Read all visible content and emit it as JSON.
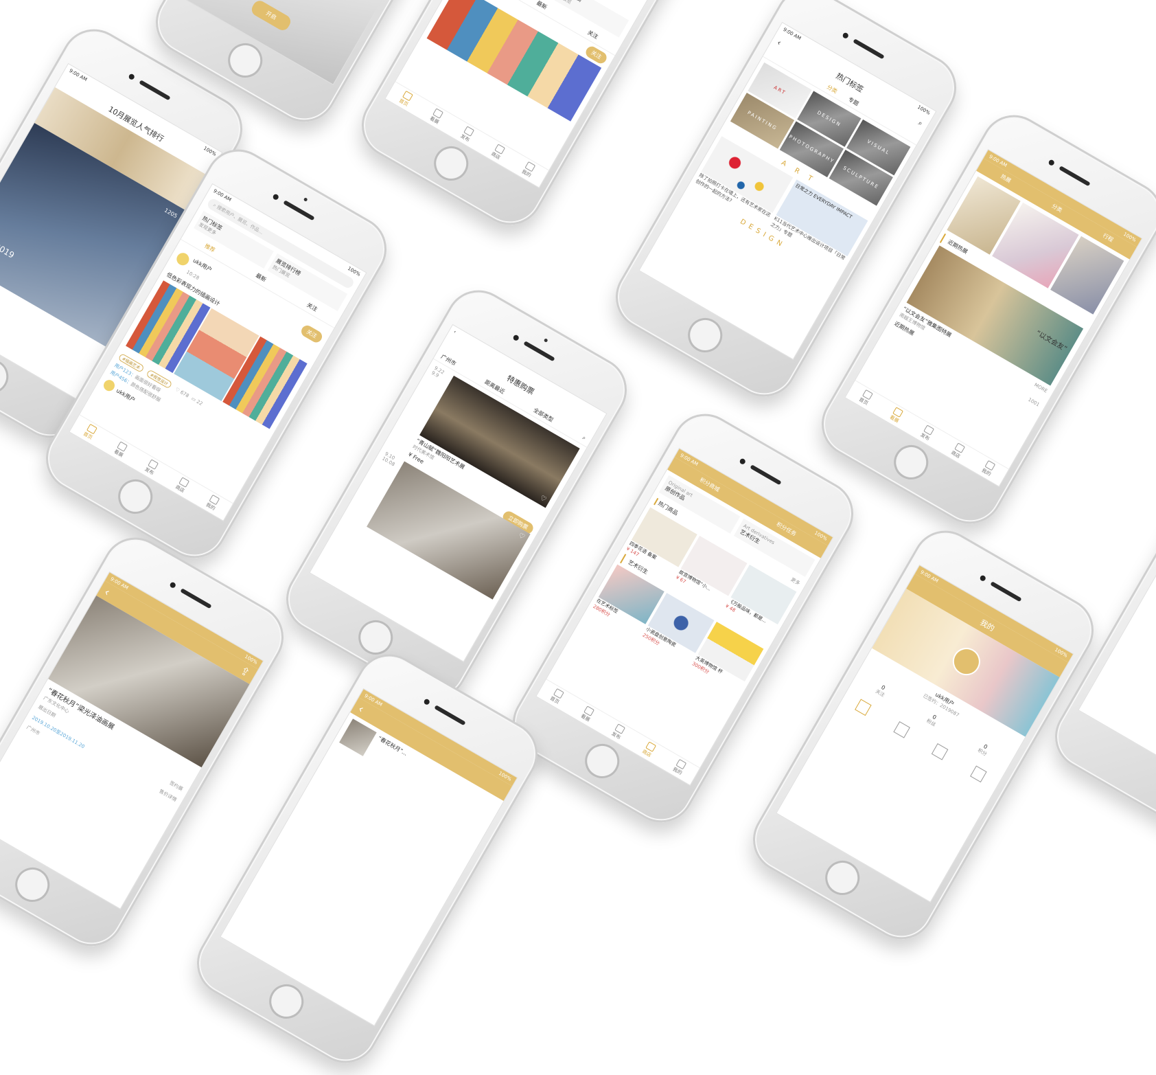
{
  "status": {
    "time": "9:00 AM",
    "battery": "100%"
  },
  "ranking": {
    "title": "10月展览人气排行",
    "views": "1205",
    "year": "2019"
  },
  "home": {
    "search_placeholder": "搜索用户、展览、作品...",
    "hot_tags": "热门标签",
    "hot_tags_sub": "发现更多",
    "rank_list": "展览排行榜",
    "rank_sub": "热门展览",
    "tabs": [
      "推荐",
      "最新",
      "关注"
    ],
    "user": "ukk用户",
    "post_time": "10:28",
    "post_text": "低色彩表现力的插画设计",
    "follow": "关注",
    "tag_a": "#插画艺术",
    "tag_b": "#视觉设计",
    "likes": "678",
    "comments": "22",
    "comment1_user": "用户123：",
    "comment1": "画面很好看呀",
    "comment2_user": "用户456：",
    "comment2": "颜色搭配很舒服"
  },
  "tabbar": [
    "首页",
    "看展",
    "发布",
    "商店",
    "我的"
  ],
  "opener": {
    "button": "开启"
  },
  "tags_page": {
    "title": "热门标签",
    "subtabs": [
      "分类",
      "专题"
    ],
    "cats": [
      "ART",
      "DESIGN",
      "VISUAL",
      "PAINTING",
      "PHOTOGRAPHY",
      "SCULPTURE"
    ],
    "art_word": "A R T",
    "design_word": "DESIGN",
    "card1": "除了拍照打卡在墙上，还有艺术家在这创作的一起的方法?",
    "card2": "K11当代艺术中心推出设计项目「日常之力」专题",
    "everyday": "日常之力 EVERYDAY IMPACT"
  },
  "tickets": {
    "title": "特惠购票",
    "city": "广州市",
    "sort": "距离最近",
    "filter": "全部类型",
    "date1": "9.22",
    "date1b": "9.9",
    "ex1": "“青山赋”魏阳阳艺术展",
    "ex1_venue": "时代美术馆",
    "price": "¥ Free",
    "date2": "9.10",
    "date2b": "10.08",
    "buy": "立即购票"
  },
  "points": {
    "tabs": [
      "积分商城",
      "积分任务"
    ],
    "original": "原创作品",
    "original_en": "Original art",
    "derivative": "艺术衍生",
    "derivative_en": "Art derivatives",
    "hot": "热门商品",
    "more": "更多",
    "item1": "四季花语 备案",
    "item1_price": "¥ 147",
    "item2": "故宫博物馆“小...",
    "item2_price": "¥ 67",
    "item3": "《万般品味，都是...",
    "item3_price": "¥ 48",
    "sect2": "艺术衍生",
    "p1": "在艺术标签",
    "p1_pts": "280积分",
    "p2": "小瓷盘创意陶瓷",
    "p2_pts": "250积分",
    "p3": "大英博物馆 杯",
    "p3_pts": "300积分"
  },
  "category_home": {
    "tabs": [
      "热展",
      "分类",
      "行程"
    ],
    "near": "近期热展",
    "ex1": "“以文会友”雅集图特展",
    "ex1_venue": "南越王博物馆",
    "ex1_sub": "“以文会友”",
    "near2": "近期热展",
    "more": "MORE",
    "views": "1001"
  },
  "detail": {
    "title": "“春花秋月”梁光泽油画展",
    "venue": "广东文化中心",
    "date_label": "展出日期",
    "date": "2019.10.20至2019.11.20",
    "sign": "签约展",
    "ticket": "售价详情",
    "address": "广州市"
  },
  "me": {
    "title": "我的",
    "user": "ukk用户",
    "uid": "已签约：2019087",
    "stats": [
      {
        "num": "0",
        "label": "关注"
      },
      {
        "num": "0",
        "label": "粉丝"
      },
      {
        "num": "0",
        "label": "积分"
      }
    ]
  },
  "mini": {
    "title": "“春花秋月”..."
  }
}
